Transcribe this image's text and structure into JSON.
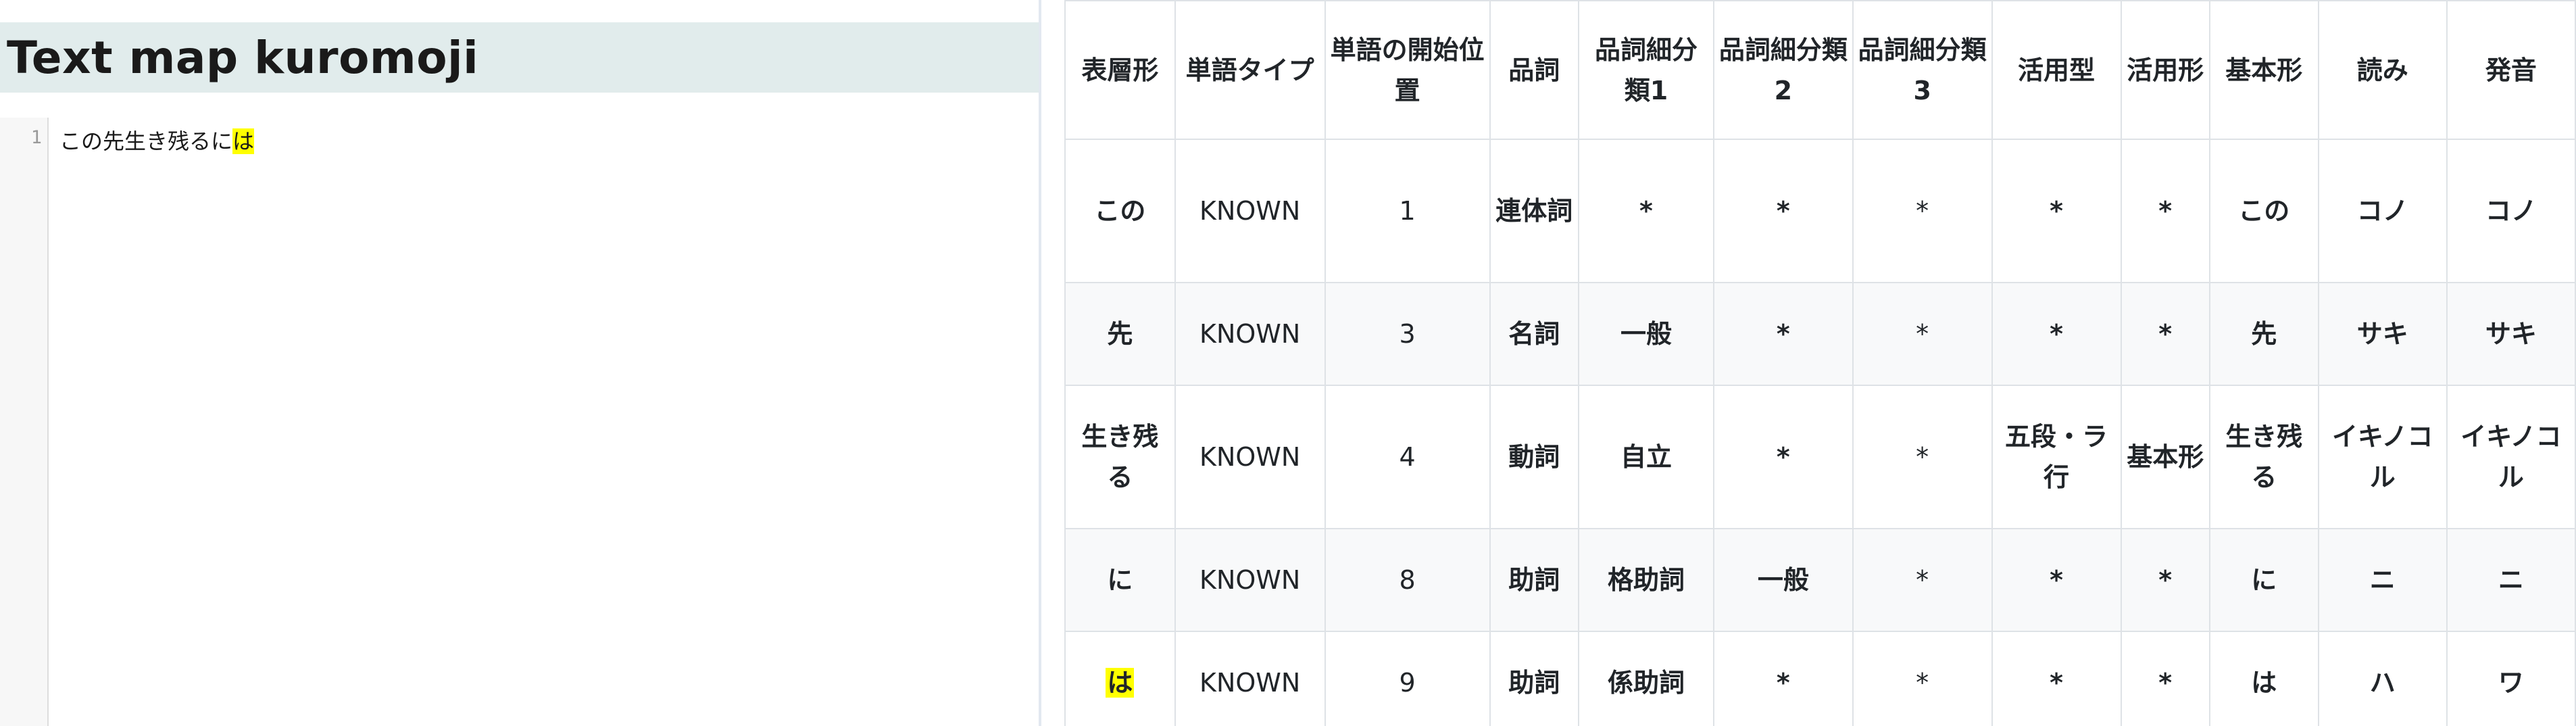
{
  "app": {
    "title": "Text map kuromoji"
  },
  "editor": {
    "line_number": "1",
    "line_text_before": "この先生き残るに",
    "line_text_highlight": "は"
  },
  "table": {
    "headers": [
      "表層形",
      "単語タイプ",
      "単語の開始位置",
      "品詞",
      "品詞細分類1",
      "品詞細分類2",
      "品詞細分類3",
      "活用型",
      "活用形",
      "基本形",
      "読み",
      "発音"
    ],
    "rows": [
      [
        "この",
        "KNOWN",
        "1",
        "連体詞",
        "*",
        "*",
        "*",
        "*",
        "*",
        "この",
        "コノ",
        "コノ"
      ],
      [
        "先",
        "KNOWN",
        "3",
        "名詞",
        "一般",
        "*",
        "*",
        "*",
        "*",
        "先",
        "サキ",
        "サキ"
      ],
      [
        "生き残る",
        "KNOWN",
        "4",
        "動詞",
        "自立",
        "*",
        "*",
        "五段・ラ行",
        "基本形",
        "生き残る",
        "イキノコル",
        "イキノコル"
      ],
      [
        "に",
        "KNOWN",
        "8",
        "助詞",
        "格助詞",
        "一般",
        "*",
        "*",
        "*",
        "に",
        "ニ",
        "ニ"
      ],
      [
        "は",
        "KNOWN",
        "9",
        "助詞",
        "係助詞",
        "*",
        "*",
        "*",
        "*",
        "は",
        "ハ",
        "ワ"
      ]
    ],
    "highlighted_row": 4
  },
  "colors": {
    "title_bar_bg": "#e1ecec",
    "highlight": "#ffff00",
    "table_stripe": "#f8f9fa",
    "border": "#dee2e6"
  }
}
